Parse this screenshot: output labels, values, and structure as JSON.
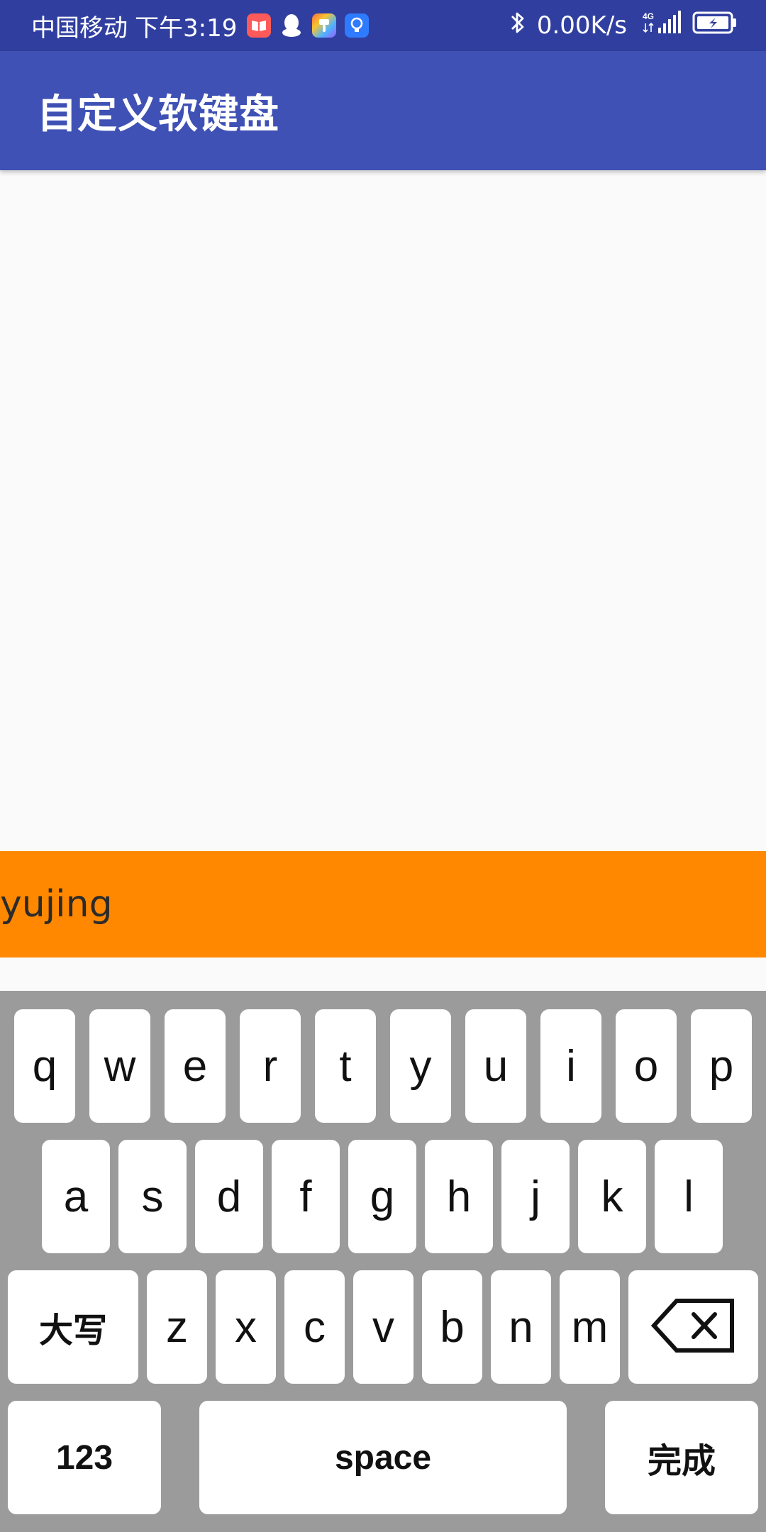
{
  "status_bar": {
    "carrier": "中国移动",
    "time": "下午3:19",
    "net_speed": "0.00K/s",
    "network_type": "4G",
    "icons": [
      "book-notification-icon",
      "qq-icon",
      "palette-app-icon",
      "lightbulb-app-icon",
      "bluetooth-icon",
      "signal-icon",
      "battery-charging-icon"
    ]
  },
  "app_bar": {
    "title": "自定义软键盘"
  },
  "input_display": {
    "text": "yujing",
    "background": "#ff8800"
  },
  "keyboard": {
    "row1": [
      "q",
      "w",
      "e",
      "r",
      "t",
      "y",
      "u",
      "i",
      "o",
      "p"
    ],
    "row2": [
      "a",
      "s",
      "d",
      "f",
      "g",
      "h",
      "j",
      "k",
      "l"
    ],
    "row3": {
      "shift_label": "大写",
      "letters": [
        "z",
        "x",
        "c",
        "v",
        "b",
        "n",
        "m"
      ],
      "delete_icon": "backspace-icon"
    },
    "row4": {
      "numbers_label": "123",
      "space_label": "space",
      "done_label": "完成"
    }
  },
  "colors": {
    "status_bar": "#303f9f",
    "app_bar": "#3f51b5",
    "keyboard_bg": "#9b9b9b",
    "key_bg": "#ffffff"
  }
}
